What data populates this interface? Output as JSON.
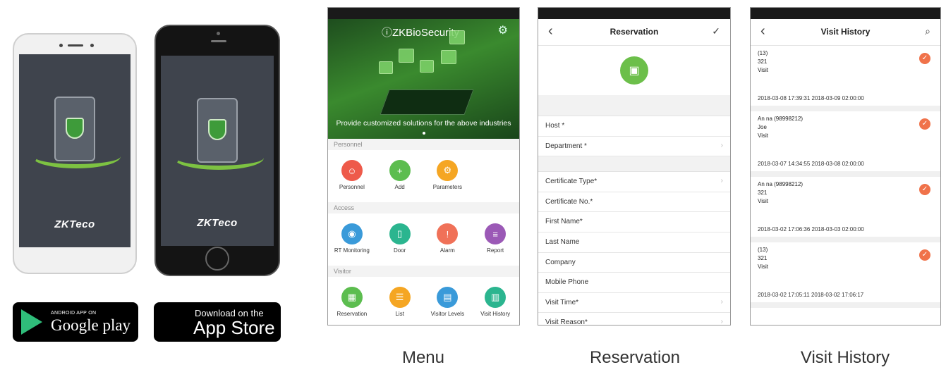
{
  "phones": {
    "brand": "ZKTeco",
    "brand_suffix": "eco"
  },
  "badges": {
    "google_small": "ANDROID APP ON",
    "google_big": "Google play",
    "apple_small": "Download on the",
    "apple_big": "App Store",
    "apple_icon": "",
    "google_icon": "play-triangle"
  },
  "menu": {
    "logo": "ZKBioSecurity",
    "banner_caption": "Provide customized solutions for the above industries",
    "sections": {
      "personnel": "Personnel",
      "access": "Access",
      "visitor": "Visitor"
    },
    "personnel_items": [
      "Personnel",
      "Add",
      "Parameters"
    ],
    "access_items": [
      "RT Monitoring",
      "Door",
      "Alarm",
      "Report"
    ],
    "visitor_items": [
      "Reservation",
      "List",
      "Visitor Levels",
      "Visit History"
    ],
    "colors": {
      "red": "#ee5a4a",
      "green": "#5cbd4f",
      "orange": "#f5a623",
      "blue": "#3a9ad9",
      "teal": "#2bb58f",
      "salmon": "#f07158",
      "purple": "#9b59b6"
    }
  },
  "reservation": {
    "title": "Reservation",
    "fields": [
      "Host *",
      "Department *",
      "Certificate Type*",
      "Certificate No.*",
      "First Name*",
      "Last Name",
      "Company",
      "Mobile Phone",
      "Visit Time*",
      "Visit Reason*"
    ]
  },
  "history": {
    "title": "Visit History",
    "records": [
      {
        "host": "(13)",
        "visitor": "321",
        "reason": "Visit",
        "start": "2018-03-08 17:39:31",
        "end": "2018-03-09 02:00:00"
      },
      {
        "host": "An na (98998212)",
        "visitor": "Joe",
        "reason": "Visit",
        "start": "2018-03-07 14:34:55",
        "end": "2018-03-08 02:00:00"
      },
      {
        "host": "An na (98998212)",
        "visitor": "321",
        "reason": "Visit",
        "start": "2018-03-02 17:06:36",
        "end": "2018-03-03 02:00:00"
      },
      {
        "host": "(13)",
        "visitor": "321",
        "reason": "Visit",
        "start": "2018-03-02 17:05:11",
        "end": "2018-03-02 17:06:17"
      }
    ]
  },
  "captions": {
    "menu": "Menu",
    "reservation": "Reservation",
    "history": "Visit History"
  }
}
